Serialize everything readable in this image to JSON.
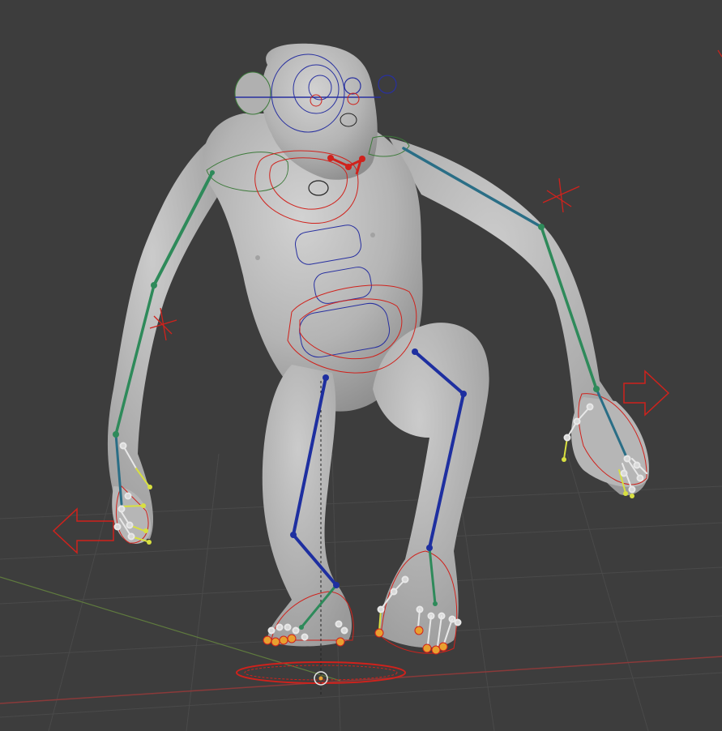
{
  "viewport": {
    "mode": "3D viewport",
    "object": "chimpanzee",
    "shading": "solid",
    "show_grid": true
  },
  "colors": {
    "background": "#3d3d3d",
    "grid": "#4a4a4a",
    "x_axis": "#8a3a3a",
    "y_axis": "#5f7a3e",
    "mesh": "#b8b8b8",
    "bone_left": "#2e8a5a",
    "bone_right": "#2a6e86",
    "bone_leg": "#1e2fa0",
    "control_red": "#d0221c",
    "control_blue": "#2830a0",
    "control_green": "#3c7a3a",
    "joint": "#e8e8e8",
    "tip": "#d8e040"
  },
  "icons": [
    "origin-icon",
    "ik-arrow-icon",
    "ik-target-icon"
  ]
}
